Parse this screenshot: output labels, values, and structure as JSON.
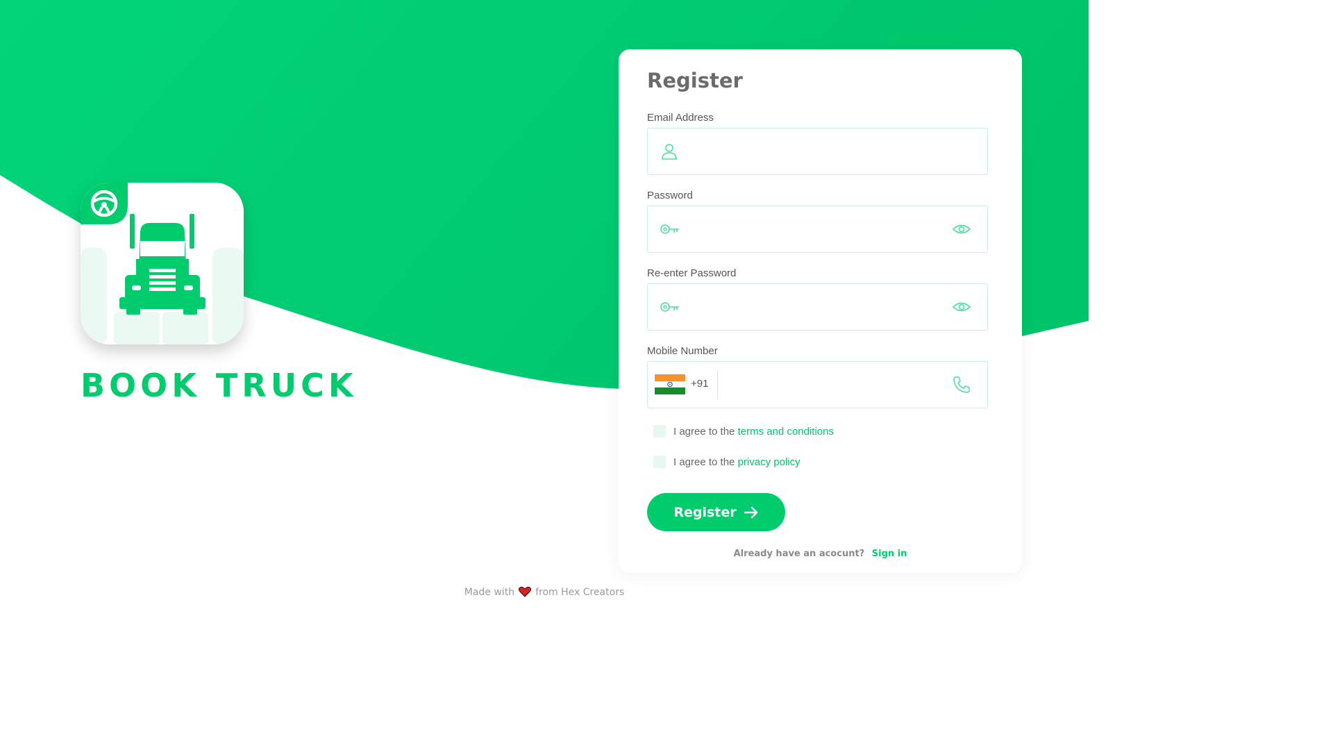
{
  "brand": {
    "name": "BOOK TRUCK",
    "accent_color": "#00cc6e",
    "logo_icons": [
      "steering-wheel-icon",
      "truck-icon"
    ]
  },
  "form": {
    "title": "Register",
    "email": {
      "label": "Email Address",
      "value": "",
      "icon": "user-icon"
    },
    "password": {
      "label": "Password",
      "value": "",
      "icon": "key-icon",
      "toggle_icon": "eye-icon"
    },
    "confirm_password": {
      "label": "Re-enter Password",
      "value": "",
      "icon": "key-icon",
      "toggle_icon": "eye-icon"
    },
    "mobile": {
      "label": "Mobile Number",
      "country_flag": "india-flag-icon",
      "dial_code": "+91",
      "value": "",
      "icon": "phone-icon"
    },
    "terms": {
      "prefix": "I agree to the",
      "link": "terms and conditions",
      "checked": false
    },
    "privacy": {
      "prefix": "I agree to the",
      "link": "privacy policy",
      "checked": false
    },
    "submit_label": "Register",
    "signin_prompt": "Already have an acocunt?",
    "signin_link": "Sign in"
  },
  "footer": {
    "made_with": "Made with",
    "heart_icon": "heart-icon",
    "from": "from Hex Creators"
  }
}
